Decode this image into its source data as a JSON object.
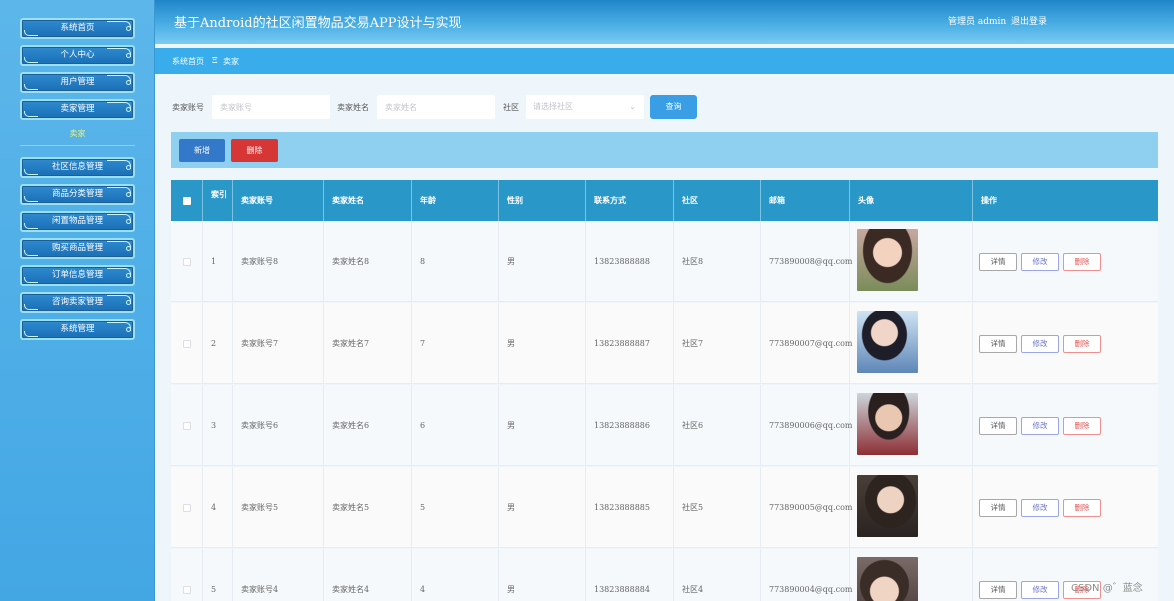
{
  "sidebar": {
    "items": [
      {
        "label": "系统首页"
      },
      {
        "label": "个人中心"
      },
      {
        "label": "用户管理"
      },
      {
        "label": "卖家管理"
      },
      {
        "label": "社区信息管理"
      },
      {
        "label": "商品分类管理"
      },
      {
        "label": "闲置物品管理"
      },
      {
        "label": "购买商品管理"
      },
      {
        "label": "订单信息管理"
      },
      {
        "label": "咨询卖家管理"
      },
      {
        "label": "系统管理"
      }
    ],
    "sub_item": "卖家"
  },
  "header": {
    "title": "基于Android的社区闲置物品交易APP设计与实现",
    "admin": "管理员 admin",
    "logout": "退出登录"
  },
  "breadcrumb": {
    "home": "系统首页",
    "separator": "Ξ",
    "current": "卖家"
  },
  "search": {
    "account_label": "卖家账号",
    "account_placeholder": "卖家账号",
    "name_label": "卖家姓名",
    "name_placeholder": "卖家姓名",
    "community_label": "社区",
    "community_placeholder": "请选择社区",
    "query_button": "查询"
  },
  "actions": {
    "add": "新增",
    "delete": "删除"
  },
  "table": {
    "columns": [
      "索引",
      "卖家账号",
      "卖家姓名",
      "年龄",
      "性别",
      "联系方式",
      "社区",
      "邮箱",
      "头像",
      "操作"
    ],
    "rows": [
      {
        "index": "1",
        "account": "卖家账号8",
        "name": "卖家姓名8",
        "age": "8",
        "gender": "男",
        "phone": "13823888888",
        "community": "社区8",
        "email": "773890008@qq.com"
      },
      {
        "index": "2",
        "account": "卖家账号7",
        "name": "卖家姓名7",
        "age": "7",
        "gender": "男",
        "phone": "13823888887",
        "community": "社区7",
        "email": "773890007@qq.com"
      },
      {
        "index": "3",
        "account": "卖家账号6",
        "name": "卖家姓名6",
        "age": "6",
        "gender": "男",
        "phone": "13823888886",
        "community": "社区6",
        "email": "773890006@qq.com"
      },
      {
        "index": "4",
        "account": "卖家账号5",
        "name": "卖家姓名5",
        "age": "5",
        "gender": "男",
        "phone": "13823888885",
        "community": "社区5",
        "email": "773890005@qq.com"
      },
      {
        "index": "5",
        "account": "卖家账号4",
        "name": "卖家姓名4",
        "age": "4",
        "gender": "男",
        "phone": "13823888884",
        "community": "社区4",
        "email": "773890004@qq.com"
      }
    ],
    "row_actions": {
      "detail": "详情",
      "edit": "修改",
      "delete": "删除"
    }
  },
  "watermark": "CSDN @゛蓝念",
  "colors": {
    "sidebar_bg": "#4aabe6",
    "header_bg": "#2a97c9",
    "accent": "#39acec",
    "danger": "#d63636",
    "primary_button": "#3479c9"
  }
}
